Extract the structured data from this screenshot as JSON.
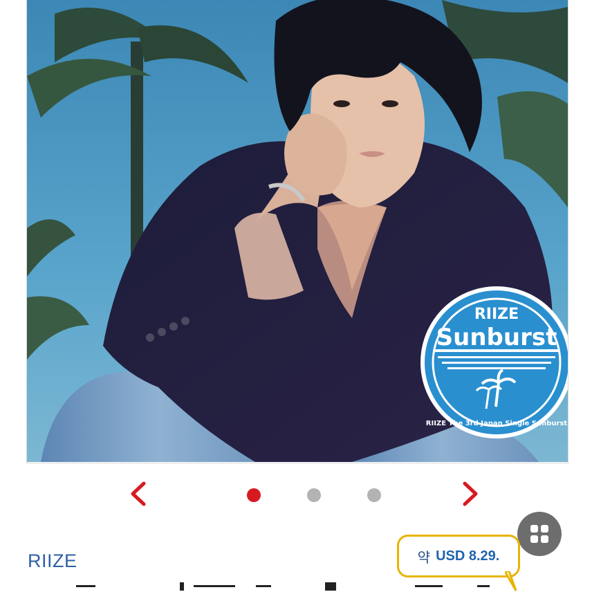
{
  "product_gallery": {
    "current_image_alt": "RIIZE Sunburst photo",
    "sticker": {
      "brand": "RIIZE",
      "title": "Sunburst",
      "subtitle": "RIIZE The 3rd Japan Single Sunburst"
    },
    "pagination": {
      "prev_icon": "chevron-left-icon",
      "next_icon": "chevron-right-icon",
      "pages": 3,
      "active_page": 1
    }
  },
  "product": {
    "artist": "RIIZE"
  },
  "price_tooltip": {
    "prefix": "약",
    "amount": "USD 8.29."
  },
  "colors": {
    "accent_red": "#d71a20",
    "link_blue": "#2d5fa6",
    "bubble_border": "#e8b400",
    "dot_inactive": "#b3b3b3"
  }
}
